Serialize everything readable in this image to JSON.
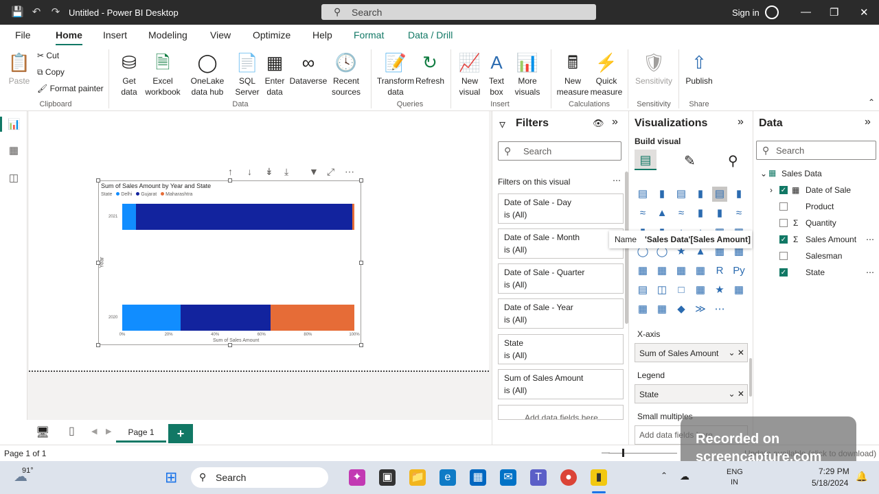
{
  "titlebar": {
    "title": "Untitled - Power BI Desktop",
    "search_placeholder": "Search",
    "signin": "Sign in"
  },
  "menu": [
    "File",
    "Home",
    "Insert",
    "Modeling",
    "View",
    "Optimize",
    "Help",
    "Format",
    "Data / Drill"
  ],
  "ribbon": {
    "paste": "Paste",
    "cut": "Cut",
    "copy": "Copy",
    "format_painter": "Format painter",
    "clipboard": "Clipboard",
    "get_data": "Get data",
    "excel": "Excel workbook",
    "onelake": "OneLake data hub",
    "sql": "SQL Server",
    "enter": "Enter data",
    "dataverse": "Dataverse",
    "recent": "Recent sources",
    "data": "Data",
    "transform": "Transform data",
    "refresh": "Refresh",
    "queries": "Queries",
    "new_visual": "New visual",
    "text_box": "Text box",
    "more_visuals": "More visuals",
    "insert": "Insert",
    "new_measure": "New measure",
    "quick_measure": "Quick measure",
    "calculations": "Calculations",
    "sensitivity_btn": "Sensitivity",
    "sensitivity": "Sensitivity",
    "publish": "Publish",
    "share": "Share"
  },
  "chart_data": {
    "type": "bar",
    "title": "Sum of Sales Amount by Year and State",
    "legend_title": "State",
    "stacked": "100%",
    "categories": [
      "2021",
      "2020"
    ],
    "series": [
      {
        "name": "Delhi",
        "color": "#118dff",
        "values": [
          6,
          25
        ]
      },
      {
        "name": "Gujarat",
        "color": "#12239e",
        "values": [
          93,
          39
        ]
      },
      {
        "name": "Maharashtra",
        "color": "#e66c37",
        "values": [
          1,
          36
        ]
      }
    ],
    "xlabel": "Sum of Sales Amount",
    "ylabel": "Year",
    "xticks": [
      "0%",
      "20%",
      "40%",
      "60%",
      "80%",
      "100%"
    ],
    "xlim": [
      0,
      100
    ]
  },
  "pages": {
    "tab": "Page 1",
    "status": "Page 1 of 1"
  },
  "filters": {
    "title": "Filters",
    "search": "Search",
    "section": "Filters on this visual",
    "cards": [
      {
        "name": "Date of Sale - Day",
        "value": "is (All)"
      },
      {
        "name": "Date of Sale - Month",
        "value": "is (All)"
      },
      {
        "name": "Date of Sale - Quarter",
        "value": "is (All)"
      },
      {
        "name": "Date of Sale - Year",
        "value": "is (All)"
      },
      {
        "name": "State",
        "value": "is (All)"
      },
      {
        "name": "Sum of Sales Amount",
        "value": "is (All)"
      }
    ],
    "add": "Add data fields here"
  },
  "viz": {
    "title": "Visualizations",
    "build": "Build visual",
    "xaxis": "X-axis",
    "xaxis_field": "Sum of Sales Amount",
    "legend": "Legend",
    "legend_field": "State",
    "small_multiples": "Small multiples",
    "add": "Add data fields here"
  },
  "data_pane": {
    "title": "Data",
    "search": "Search",
    "table": "Sales Data",
    "fields": [
      {
        "name": "Date of Sale",
        "checked": true
      },
      {
        "name": "Product",
        "checked": false
      },
      {
        "name": "Quantity",
        "checked": false
      },
      {
        "name": "Sales Amount",
        "checked": true
      },
      {
        "name": "Salesman",
        "checked": false
      },
      {
        "name": "State",
        "checked": true
      }
    ]
  },
  "tooltip": {
    "label": "Name",
    "value": "'Sales Data'[Sales Amount]"
  },
  "watermark": {
    "line1": "Recorded on",
    "line2": "screencapture.com"
  },
  "status_right": "Update available (click to download)",
  "taskbar": {
    "temp": "91°",
    "search": "Search",
    "lang1": "ENG",
    "lang2": "IN",
    "time": "7:29 PM",
    "date": "5/18/2024"
  }
}
